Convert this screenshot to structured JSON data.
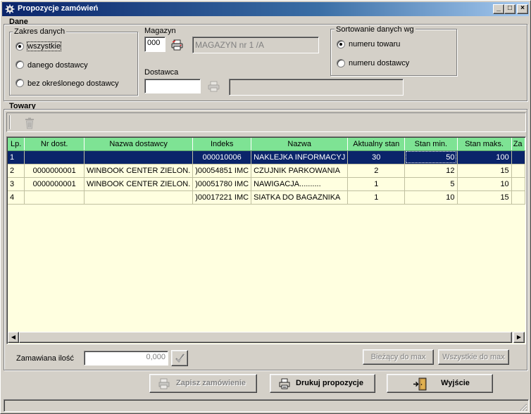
{
  "window": {
    "title": "Propozycje zamówień",
    "controls": {
      "minimize": "_",
      "maximize": "□",
      "close": "×"
    }
  },
  "dane": {
    "section_title": "Dane",
    "zakres": {
      "label": "Zakres danych",
      "options": [
        {
          "label": "wszystkie",
          "checked": true
        },
        {
          "label": "danego dostawcy",
          "checked": false
        },
        {
          "label": "bez określonego dostawcy",
          "checked": false
        }
      ]
    },
    "magazyn": {
      "label": "Magazyn",
      "code": "000",
      "name": "MAGAZYN nr 1 /A",
      "lookup_icon": "printer-lookup-icon"
    },
    "dostawca": {
      "label": "Dostawca",
      "code": "",
      "name": "",
      "lookup_icon": "printer-lookup-icon"
    },
    "sortowanie": {
      "label": "Sortowanie danych wg",
      "options": [
        {
          "label": "numeru towaru",
          "checked": true
        },
        {
          "label": "numeru dostawcy",
          "checked": false
        }
      ]
    }
  },
  "towary": {
    "section_title": "Towary",
    "toolbar": {
      "delete_icon": "trash-icon"
    },
    "columns": [
      "Lp.",
      "Nr dost.",
      "Nazwa dostawcy",
      "Indeks",
      "Nazwa",
      "Aktualny stan",
      "Stan min.",
      "Stan maks.",
      "Za"
    ],
    "rows": [
      {
        "lp": "1",
        "nr_dost": "",
        "nazwa_dostawcy": "",
        "indeks": "000010006",
        "nazwa": "NAKLEJKA INFORMACYJ",
        "aktualny": "30",
        "min": "50",
        "maks": "100",
        "za": "",
        "selected": true
      },
      {
        "lp": "2",
        "nr_dost": "0000000001",
        "nazwa_dostawcy": "WINBOOK CENTER ZIELON.",
        "indeks": ")00054851 IMC",
        "nazwa": "CZUJNIK PARKOWANIA",
        "aktualny": "2",
        "min": "12",
        "maks": "15",
        "za": "",
        "selected": false
      },
      {
        "lp": "3",
        "nr_dost": "0000000001",
        "nazwa_dostawcy": "WINBOOK CENTER ZIELON.",
        "indeks": ")00051780 IMC",
        "nazwa": "NAWIGACJA..........",
        "aktualny": "1",
        "min": "5",
        "maks": "10",
        "za": "",
        "selected": false
      },
      {
        "lp": "4",
        "nr_dost": "",
        "nazwa_dostawcy": "",
        "indeks": ")00017221 IMC",
        "nazwa": "SIATKA DO BAGAZNIKA",
        "aktualny": "1",
        "min": "10",
        "maks": "15",
        "za": "",
        "selected": false
      }
    ]
  },
  "quantity": {
    "label": "Zamawiana ilość",
    "value": "0,000",
    "confirm_icon": "checkmark-icon",
    "btn_current_max": "Bieżący do max",
    "btn_all_max": "Wszystkie do max"
  },
  "actions": {
    "save": "Zapisz zamówienie",
    "print": "Drukuj propozycje",
    "exit": "Wyjście"
  },
  "colors": {
    "header_green": "#7ee394",
    "grid_background": "#ffffe0",
    "selection": "#0a246a",
    "titlebar": "#0a246a"
  }
}
